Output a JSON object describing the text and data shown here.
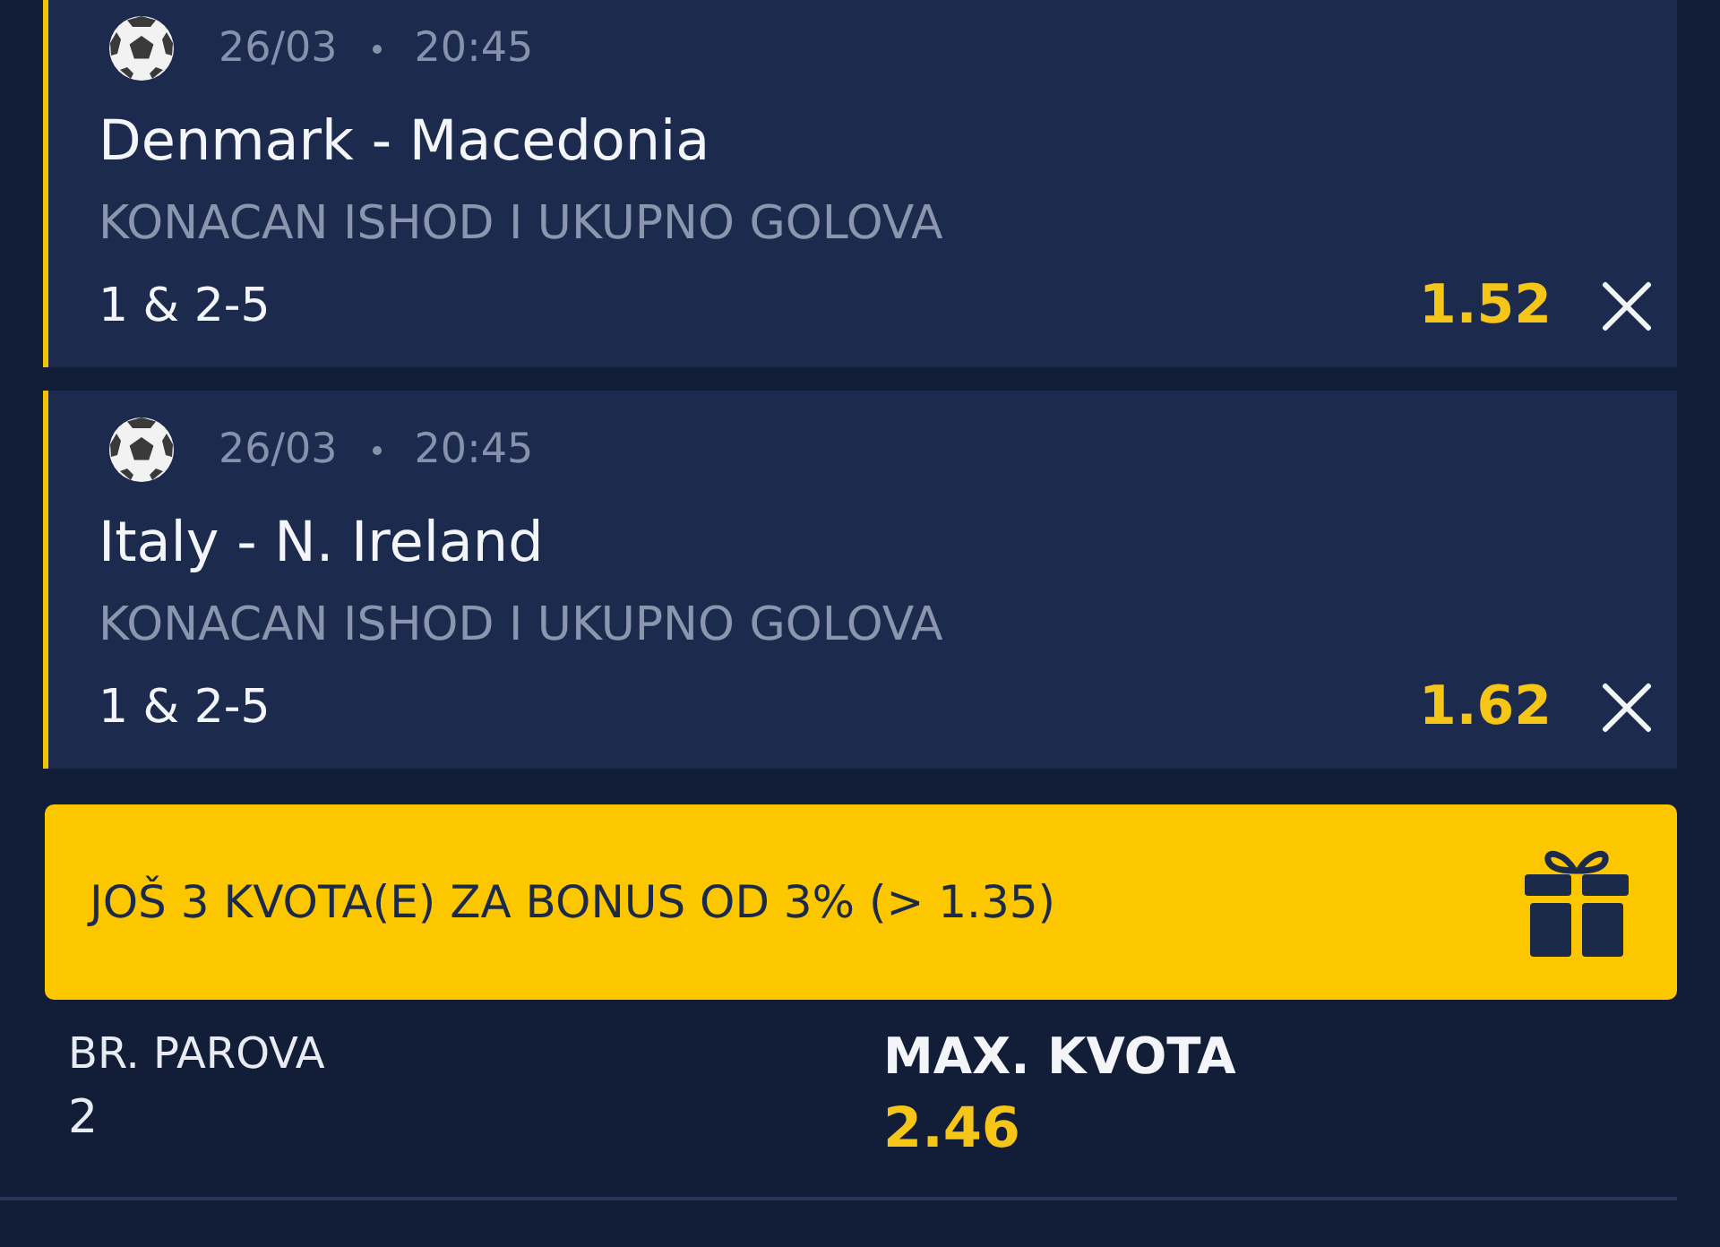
{
  "bets": [
    {
      "kind": "football",
      "date": "26/03",
      "time": "20:45",
      "match": "Denmark - Macedonia",
      "market": "KONACAN ISHOD I UKUPNO GOLOVA",
      "selection": "1 & 2-5",
      "odds": "1.52"
    },
    {
      "kind": "football",
      "date": "26/03",
      "time": "20:45",
      "match": "Italy - N. Ireland",
      "market": "KONACAN ISHOD I UKUPNO GOLOVA",
      "selection": "1 & 2-5",
      "odds": "1.62"
    }
  ],
  "bonus_banner": {
    "text": "JOŠ 3 KVOTA(E) ZA BONUS OD 3% (> 1.35)"
  },
  "summary": [
    {
      "kind": "plain",
      "label": "BR. PAROVA",
      "value": "2"
    },
    {
      "kind": "highlight",
      "label": "MAX. KVOTA",
      "value": "2.46"
    }
  ]
}
